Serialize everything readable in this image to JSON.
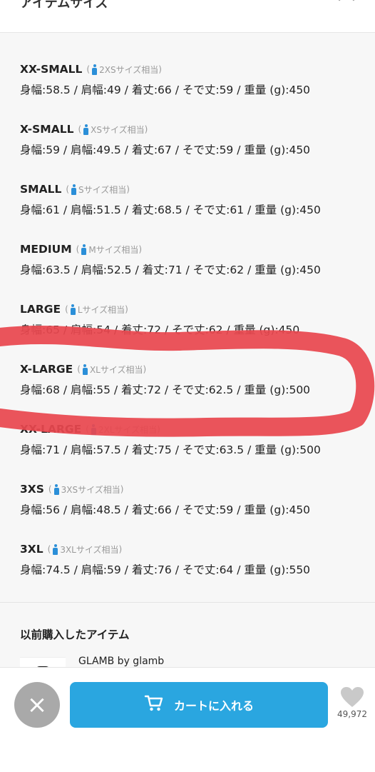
{
  "header": {
    "title": "アイテムサイズ"
  },
  "sizes": [
    {
      "name": "XX-SMALL",
      "hint": "2XSサイズ相当",
      "measure": "身幅:58.5 / 肩幅:49 / 着丈:66 / そで丈:59 / 重量 (g):450"
    },
    {
      "name": "X-SMALL",
      "hint": "XSサイズ相当",
      "measure": "身幅:59 / 肩幅:49.5 / 着丈:67 / そで丈:59 / 重量 (g):450"
    },
    {
      "name": "SMALL",
      "hint": "Sサイズ相当",
      "measure": "身幅:61 / 肩幅:51.5 / 着丈:68.5 / そで丈:61 / 重量 (g):450"
    },
    {
      "name": "MEDIUM",
      "hint": "Mサイズ相当",
      "measure": "身幅:63.5 / 肩幅:52.5 / 着丈:71 / そで丈:62 / 重量 (g):450"
    },
    {
      "name": "LARGE",
      "hint": "Lサイズ相当",
      "measure": "身幅:65 / 肩幅:54 / 着丈:72 / そで丈:62 / 重量 (g):450"
    },
    {
      "name": "X-LARGE",
      "hint": "XLサイズ相当",
      "measure": "身幅:68 / 肩幅:55 / 着丈:72 / そで丈:62.5 / 重量 (g):500"
    },
    {
      "name": "XX-LARGE",
      "hint": "2XLサイズ相当",
      "measure": "身幅:71 / 肩幅:57.5 / 着丈:75 / そで丈:63.5 / 重量 (g):500"
    },
    {
      "name": "3XS",
      "hint": "3XSサイズ相当",
      "measure": "身幅:56 / 肩幅:48.5 / 着丈:66 / そで丈:59 / 重量 (g):450"
    },
    {
      "name": "3XL",
      "hint": "3XLサイズ相当",
      "measure": "身幅:74.5 / 肩幅:59 / 着丈:76 / そで丈:64 / 重量 (g):550"
    }
  ],
  "paren_open": "(",
  "paren_close": ")",
  "previous": {
    "title": "以前購入したアイテム",
    "brand": "GLAMB by glamb"
  },
  "bottom": {
    "close_label": "×",
    "cart_label": "カートに入れる",
    "favorite_count": "49,972"
  },
  "colors": {
    "accent": "#2aa6e0",
    "annotation": "#e8474f",
    "icon_blue": "#2b8fd8"
  },
  "icons": [
    "chevron-up-icon",
    "person-icon",
    "close-icon",
    "cart-icon",
    "heart-icon"
  ]
}
